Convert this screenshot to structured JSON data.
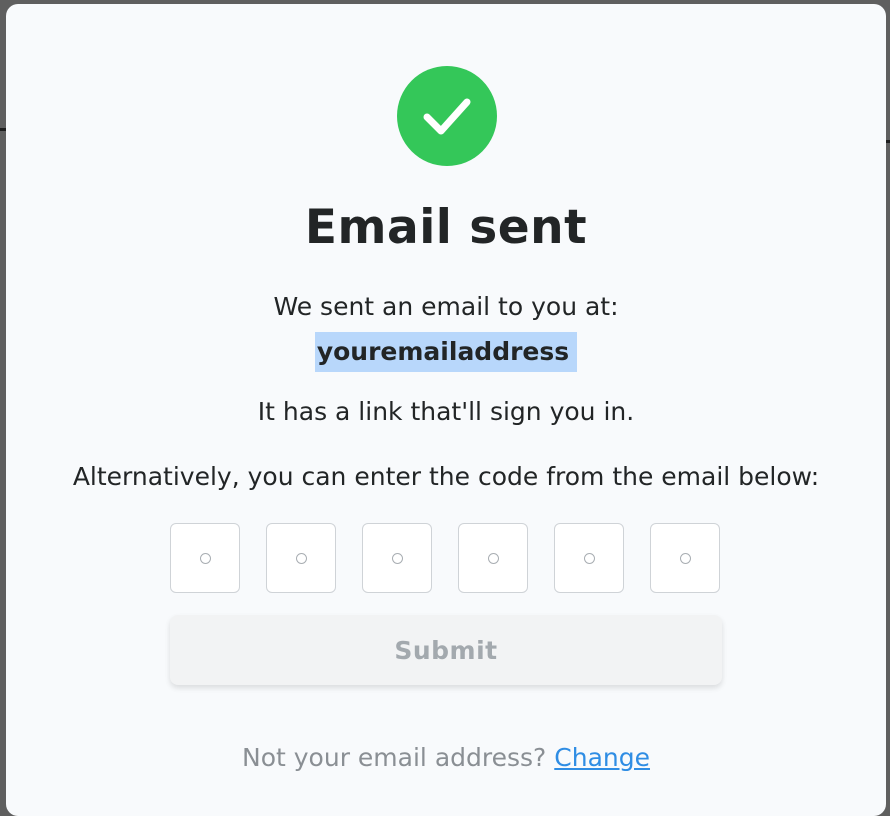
{
  "modal": {
    "title": "Email sent",
    "sent_message": "We sent an email to you at:",
    "email": "youremailaddress",
    "link_message": "It has a link that'll sign you in.",
    "alternative_message": "Alternatively, you can enter the code from the email below:",
    "code_boxes": [
      "",
      "",
      "",
      "",
      "",
      ""
    ],
    "submit_label": "Submit",
    "footer_prompt": "Not your email address?",
    "change_label": "Change"
  },
  "colors": {
    "success": "#34c759",
    "email_highlight": "#b8d7fb",
    "link": "#2f8de4",
    "submit_disabled_text": "#a3a9ae"
  },
  "icons": {
    "success": "check-icon"
  }
}
